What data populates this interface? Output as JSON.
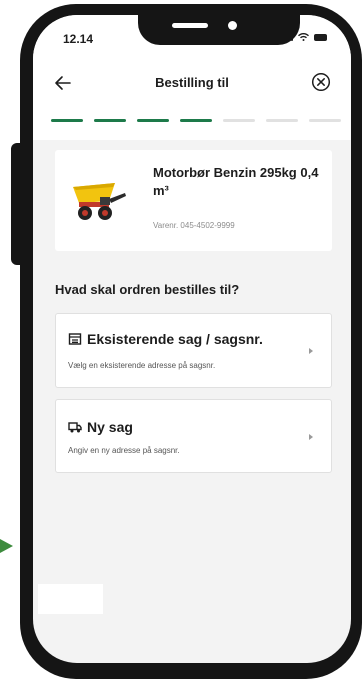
{
  "status_bar": {
    "time": "12.14"
  },
  "nav": {
    "title": "Bestilling til"
  },
  "progress": {
    "total_steps": 7,
    "completed_steps": 4,
    "active_color": "#1d7a4a"
  },
  "product": {
    "name": "Motorbør Benzin 295kg 0,4 m³",
    "sku": "Varenr. 045-4502-9999"
  },
  "section_title": "Hvad skal ordren bestilles til?",
  "options": [
    {
      "icon": "address-book-icon",
      "title": "Eksisterende sag / sagsnr.",
      "subtitle": "Vælg en eksisterende adresse på sagsnr."
    },
    {
      "icon": "truck-icon",
      "title": "Ny sag",
      "subtitle": "Angiv en ny adresse på sagsnr."
    }
  ]
}
